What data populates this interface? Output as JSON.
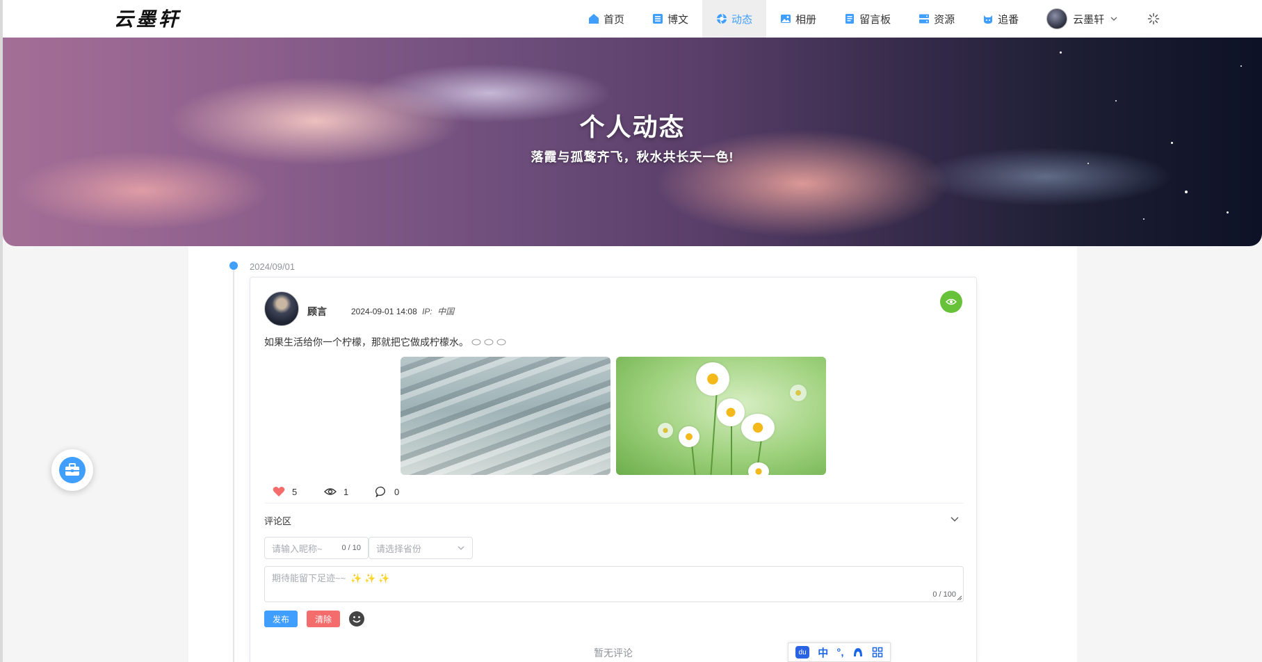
{
  "site": {
    "logo": "云墨轩"
  },
  "nav": {
    "items": [
      {
        "label": "首页",
        "icon": "home-icon",
        "active": false
      },
      {
        "label": "博文",
        "icon": "list-icon",
        "active": false
      },
      {
        "label": "动态",
        "icon": "aperture-icon",
        "active": true
      },
      {
        "label": "相册",
        "icon": "image-icon",
        "active": false
      },
      {
        "label": "留言板",
        "icon": "message-board-icon",
        "active": false
      },
      {
        "label": "资源",
        "icon": "server-icon",
        "active": false
      },
      {
        "label": "追番",
        "icon": "cat-icon",
        "active": false
      }
    ],
    "user": {
      "name": "云墨轩"
    }
  },
  "banner": {
    "title": "个人动态",
    "subtitle": "落霞与孤鹜齐飞，秋水共长天一色!"
  },
  "timeline": {
    "date": "2024/09/01",
    "post": {
      "author": "顾言",
      "time": "2024-09-01 14:08",
      "ip_label": "IP:",
      "ip_value": "中国",
      "text": "如果生活给你一个柠檬，那就把它做成柠檬水。",
      "images": [
        "sand-dunes",
        "daisies"
      ],
      "stats": {
        "likes": "5",
        "views": "1",
        "comments": "0"
      },
      "comment_section": {
        "title": "评论区",
        "nickname_placeholder": "请输入昵称~",
        "nickname_count": "0 / 10",
        "province_placeholder": "请选择省份",
        "content_placeholder": "期待能留下足迹~~",
        "content_count": "0 / 100",
        "publish_label": "发布",
        "clear_label": "清除",
        "empty_text": "暂无评论"
      }
    }
  },
  "colors": {
    "accent": "#409eff",
    "like": "#f56c6c",
    "badge": "#67c23a",
    "danger": "#f56c6c"
  },
  "ime": {
    "mode": "中"
  }
}
